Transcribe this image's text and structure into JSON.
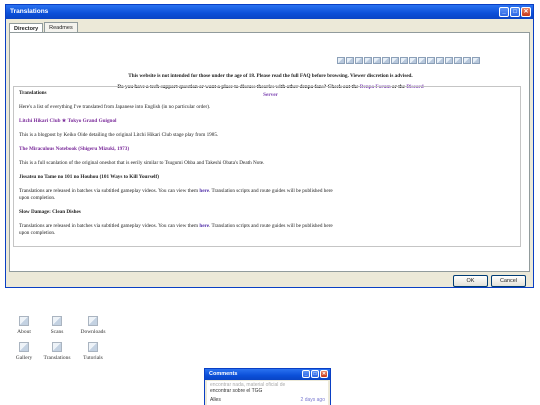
{
  "window": {
    "title": "Translations",
    "tabs": [
      "Directory",
      "Readmes"
    ],
    "buttons": {
      "ok": "OK",
      "cancel": "Cancel"
    }
  },
  "notices": {
    "age": "This website is not intended for those under the age of 18. Please read the full FAQ before browsing. Viewer discretion is advised.",
    "support_line1": "Do you have a tech support question or want a place to discuss theories with other denpa fans? Check out the",
    "support_link1": "Denpa Forum",
    "support_or": "or the",
    "support_link2": "Discord",
    "support_line2": "Server"
  },
  "content": {
    "heading": "Translations",
    "intro": "Here's a list of everything I've translated from Japanese into English (in no particular order).",
    "item1_title": "Litchi Hikari Club ★ Tokyo Grand Guignol",
    "item1_desc": "This is a blogpost by Keiko Oide detailing the original Litchi Hikari Club stage play from 1985.",
    "item2_title": "The Miraculous Notebook (Shigeru Mizuki, 1973)",
    "item2_desc": "This is a full scanlation of the original oneshot that is eerily similar to Tsugumi Ohba and Takeshi Obata's Death Note.",
    "item3_title": "Jissatsu no Tame no 101 no Houhou (101 Ways to Kill Yourself)",
    "item3_desc_pre": "Translations are released in batches via subtitled gameplay videos. You can view them",
    "item3_link": "here",
    "item3_desc_post": ". Translation scripts and route guides will be published here",
    "item3_desc_end": "upon completion.",
    "item4_title": "Slow Damage: Clean Dishes",
    "item4_desc_pre": "Translations are released in batches via subtitled gameplay videos. You can view them",
    "item4_link": "here",
    "item4_desc_post": ". Translation scripts and route guides will be published here",
    "item4_desc_end": "upon completion."
  },
  "desktop": {
    "about": "About",
    "scans": "Scans",
    "downloads": "Downloads",
    "gallery": "Gallery",
    "translations": "Translations",
    "tutorials": "Tutorials"
  },
  "comments": {
    "title": "Comments",
    "faded": "encontrar nada, material oficial de",
    "text": "encontrar sobre el TGG",
    "author": "Alles",
    "time": "2 days ago"
  },
  "colors": {
    "titlebar": "#0b4fd8",
    "window_bg": "#ece9d8",
    "link_purple": "#7a2a9a"
  },
  "icons": [
    "minimize-icon",
    "maximize-icon",
    "close-icon",
    "broken-image-icon"
  ]
}
